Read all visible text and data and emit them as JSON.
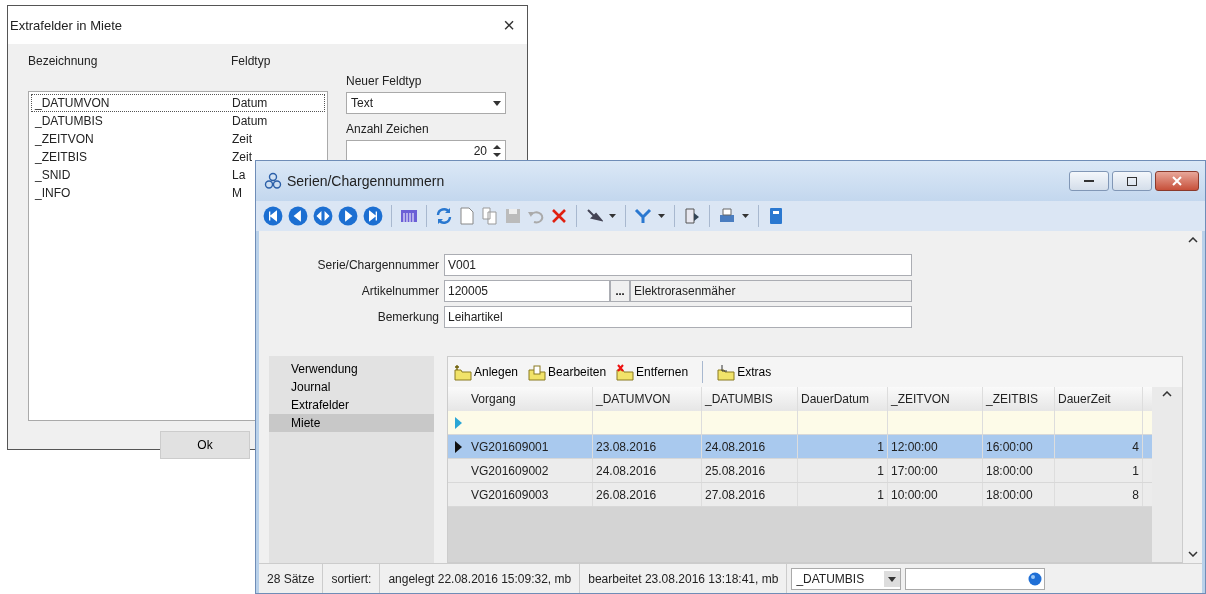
{
  "dialog": {
    "title": "Extrafelder in Miete",
    "close": "×",
    "columns": [
      "Bezeichnung",
      "Feldtyp"
    ],
    "fields": [
      {
        "name": "_DATUMVON",
        "type": "Datum",
        "selected": true
      },
      {
        "name": "_DATUMBIS",
        "type": "Datum",
        "selected": false
      },
      {
        "name": "_ZEITVON",
        "type": "Zeit",
        "selected": false
      },
      {
        "name": "_ZEITBIS",
        "type": "Zeit",
        "selected": false
      },
      {
        "name": "_SNID",
        "type": "La",
        "selected": false
      },
      {
        "name": "_INFO",
        "type": "M",
        "selected": false
      }
    ],
    "new_type_label": "Neuer Feldtyp",
    "new_type": "Text",
    "count_label": "Anzahl Zeichen",
    "count": "20",
    "ok": "Ok"
  },
  "window": {
    "title": "Serien/Chargennummern",
    "form": [
      {
        "label": "Serie/Chargennummer",
        "value": "V001",
        "kind": "text"
      },
      {
        "label": "Artikelnummer",
        "value": "120005",
        "lookup": "...",
        "description": "Elektrorasenmäher",
        "kind": "lookup"
      },
      {
        "label": "Bemerkung",
        "value": "Leihartikel",
        "kind": "text"
      }
    ],
    "nav": [
      {
        "label": "Verwendung",
        "selected": false
      },
      {
        "label": "Journal",
        "selected": false
      },
      {
        "label": "Extrafelder",
        "selected": false
      },
      {
        "label": "Miete",
        "selected": true
      }
    ],
    "grid_actions": [
      {
        "label": "Anlegen",
        "kind": "new"
      },
      {
        "label": "Bearbeiten",
        "kind": "edit"
      },
      {
        "label": "Entfernen",
        "kind": "delete"
      },
      {
        "label": "Extras",
        "kind": "extras"
      }
    ],
    "table": {
      "columns": [
        "Vorgang",
        "_DATUMVON",
        "_DATUMBIS",
        "DauerDatum",
        "_ZEITVON",
        "_ZEITBIS",
        "DauerZeit"
      ],
      "rows": [
        {
          "cells": [
            "VG201609001",
            "23.08.2016",
            "24.08.2016",
            "1",
            "12:00:00",
            "16:00:00",
            "4"
          ],
          "selected": true
        },
        {
          "cells": [
            "VG201609002",
            "24.08.2016",
            "25.08.2016",
            "1",
            "17:00:00",
            "18:00:00",
            "1"
          ],
          "selected": false
        },
        {
          "cells": [
            "VG201609003",
            "26.08.2016",
            "27.08.2016",
            "1",
            "10:00:00",
            "18:00:00",
            "8"
          ],
          "selected": false
        }
      ]
    },
    "status_bar": {
      "count": "28 Sätze",
      "sort": "sortiert:",
      "created": "angelegt 22.08.2016 15:09:32, mb",
      "edited": "bearbeitet 23.08.2016 13:18:41, mb",
      "field": "_DATUMBIS"
    }
  }
}
